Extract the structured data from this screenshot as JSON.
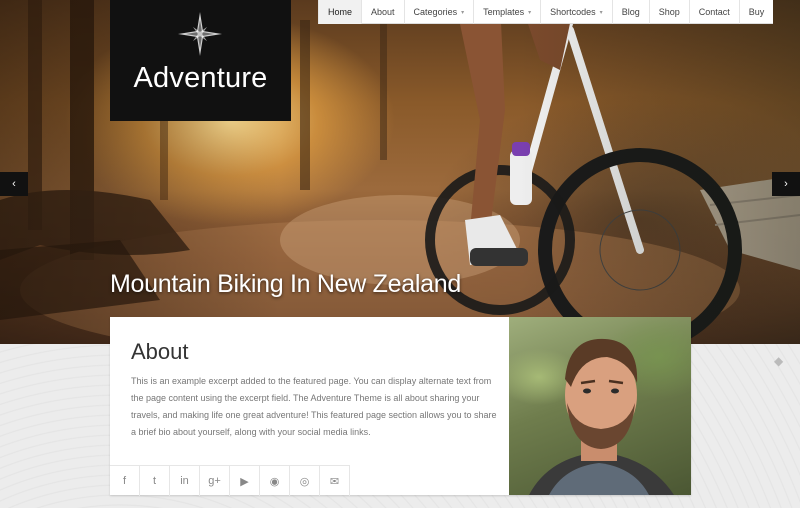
{
  "site": {
    "logo_text": "Adventure"
  },
  "nav": {
    "items": [
      {
        "label": "Home",
        "dropdown": false,
        "active": true
      },
      {
        "label": "About",
        "dropdown": false
      },
      {
        "label": "Categories",
        "dropdown": true
      },
      {
        "label": "Templates",
        "dropdown": true
      },
      {
        "label": "Shortcodes",
        "dropdown": true
      },
      {
        "label": "Blog",
        "dropdown": false
      },
      {
        "label": "Shop",
        "dropdown": false
      },
      {
        "label": "Contact",
        "dropdown": false
      },
      {
        "label": "Buy",
        "dropdown": false
      }
    ],
    "caret": "▾"
  },
  "slider": {
    "prev_icon": "‹",
    "next_icon": "›",
    "caption": "Mountain Biking In New Zealand"
  },
  "about": {
    "title": "About",
    "text": "This is an example excerpt added to the featured page. You can display alternate text from the page content using the excerpt field. The Adventure Theme is all about sharing your travels, and making life one great adventure! This featured page section allows you to share a brief bio about yourself, along with your social media links.",
    "social": [
      {
        "name": "facebook-icon",
        "glyph": "f"
      },
      {
        "name": "twitter-icon",
        "glyph": "t"
      },
      {
        "name": "linkedin-icon",
        "glyph": "in"
      },
      {
        "name": "google-plus-icon",
        "glyph": "g+"
      },
      {
        "name": "youtube-icon",
        "glyph": "▶"
      },
      {
        "name": "github-icon",
        "glyph": "◉"
      },
      {
        "name": "dribbble-icon",
        "glyph": "◎"
      },
      {
        "name": "email-icon",
        "glyph": "✉"
      }
    ]
  },
  "colors": {
    "logo_bg": "#111111",
    "nav_bg": "#ffffff",
    "page_bg": "#e9e9e9"
  },
  "edge_icon": "◆"
}
